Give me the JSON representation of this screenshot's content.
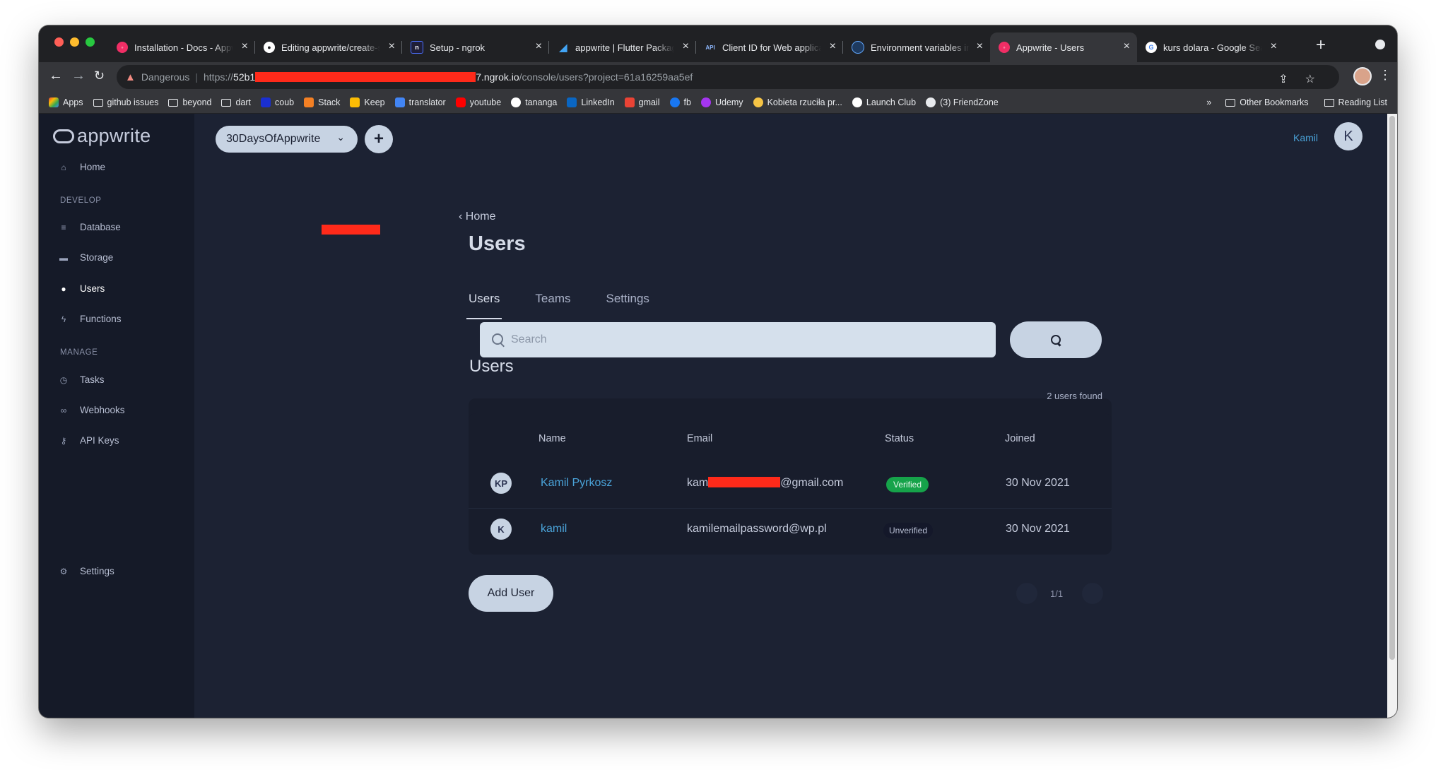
{
  "browser": {
    "tabs": [
      {
        "title": "Installation - Docs - Appwrite",
        "icon": "appwrite-icon",
        "color": "#f02e65"
      },
      {
        "title": "Editing appwrite/create-sdk",
        "icon": "github-icon",
        "color": "#ffffff"
      },
      {
        "title": "Setup - ngrok",
        "icon": "ngrok-icon",
        "color": "#1f1e37"
      },
      {
        "title": "appwrite | Flutter Package",
        "icon": "flutter-icon",
        "color": "#42a5f5"
      },
      {
        "title": "Client ID for Web application",
        "icon": "api-icon",
        "color": "#4285f4"
      },
      {
        "title": "Environment variables in C",
        "icon": "env-icon",
        "color": "#3b82f6"
      },
      {
        "title": "Appwrite - Users",
        "icon": "appwrite-icon",
        "color": "#f02e65"
      },
      {
        "title": "kurs dolara - Google Search",
        "icon": "google-icon",
        "color": "#4285f4"
      }
    ],
    "active_tab": 6,
    "url": {
      "security_label": "Dangerous",
      "scheme": "https://",
      "host_prefix": "52b1",
      "host_suffix": "7.ngrok.io",
      "path": "/console/users?project=61a16259aa5ef"
    },
    "bookmarks": [
      {
        "label": "Apps",
        "icon": "apps-grid-icon"
      },
      {
        "label": "github issues",
        "icon": "folder-icon"
      },
      {
        "label": "beyond",
        "icon": "folder-icon"
      },
      {
        "label": "dart",
        "icon": "folder-icon"
      },
      {
        "label": "coub",
        "icon": "coub-icon"
      },
      {
        "label": "Stack",
        "icon": "stackoverflow-icon"
      },
      {
        "label": "Keep",
        "icon": "keep-icon"
      },
      {
        "label": "translator",
        "icon": "translate-icon"
      },
      {
        "label": "youtube",
        "icon": "youtube-icon"
      },
      {
        "label": "tananga",
        "icon": "github-icon"
      },
      {
        "label": "LinkedIn",
        "icon": "linkedin-icon"
      },
      {
        "label": "gmail",
        "icon": "gmail-icon"
      },
      {
        "label": "fb",
        "icon": "facebook-icon"
      },
      {
        "label": "Udemy",
        "icon": "udemy-icon"
      },
      {
        "label": "Kobieta rzuciła pr...",
        "icon": "hand-icon"
      },
      {
        "label": "Launch Club",
        "icon": "launch-club-icon"
      },
      {
        "label": "(3) FriendZone",
        "icon": "chat-icon"
      }
    ],
    "bookmarks_overflow": "»",
    "other_bookmarks": "Other Bookmarks",
    "reading_list": "Reading List"
  },
  "app": {
    "logo": "appwrite",
    "project": "30DaysOfAppwrite",
    "user_name": "Kamil",
    "user_initial": "K",
    "sidebar": {
      "home": "Home",
      "develop_label": "DEVELOP",
      "develop": [
        "Database",
        "Storage",
        "Users",
        "Functions"
      ],
      "manage_label": "MANAGE",
      "manage": [
        "Tasks",
        "Webhooks",
        "API Keys"
      ],
      "settings": "Settings"
    },
    "breadcrumb": "Home",
    "page_title": "Users",
    "tabs": [
      "Users",
      "Teams",
      "Settings"
    ],
    "section_title": "Users",
    "search_placeholder": "Search",
    "found_text": "2 users found",
    "table": {
      "headers": [
        "Name",
        "Email",
        "Status",
        "Joined"
      ],
      "rows": [
        {
          "initials": "KP",
          "name": "Kamil Pyrkosz",
          "email_start": "kam",
          "email_end": "@gmail.com",
          "status": "Verified",
          "joined": "30 Nov 2021"
        },
        {
          "initials": "K",
          "name": "kamil",
          "email": "kamilemailpassword@wp.pl",
          "status": "Unverified",
          "joined": "30 Nov 2021"
        }
      ]
    },
    "add_user": "Add User",
    "pagination": "1/1"
  },
  "colors": {
    "app_bg": "#1c2233",
    "sidebar_bg": "#151a28",
    "accent_link": "#4aa3d9",
    "verified": "#16a34a",
    "redaction": "#ff2a1a"
  }
}
